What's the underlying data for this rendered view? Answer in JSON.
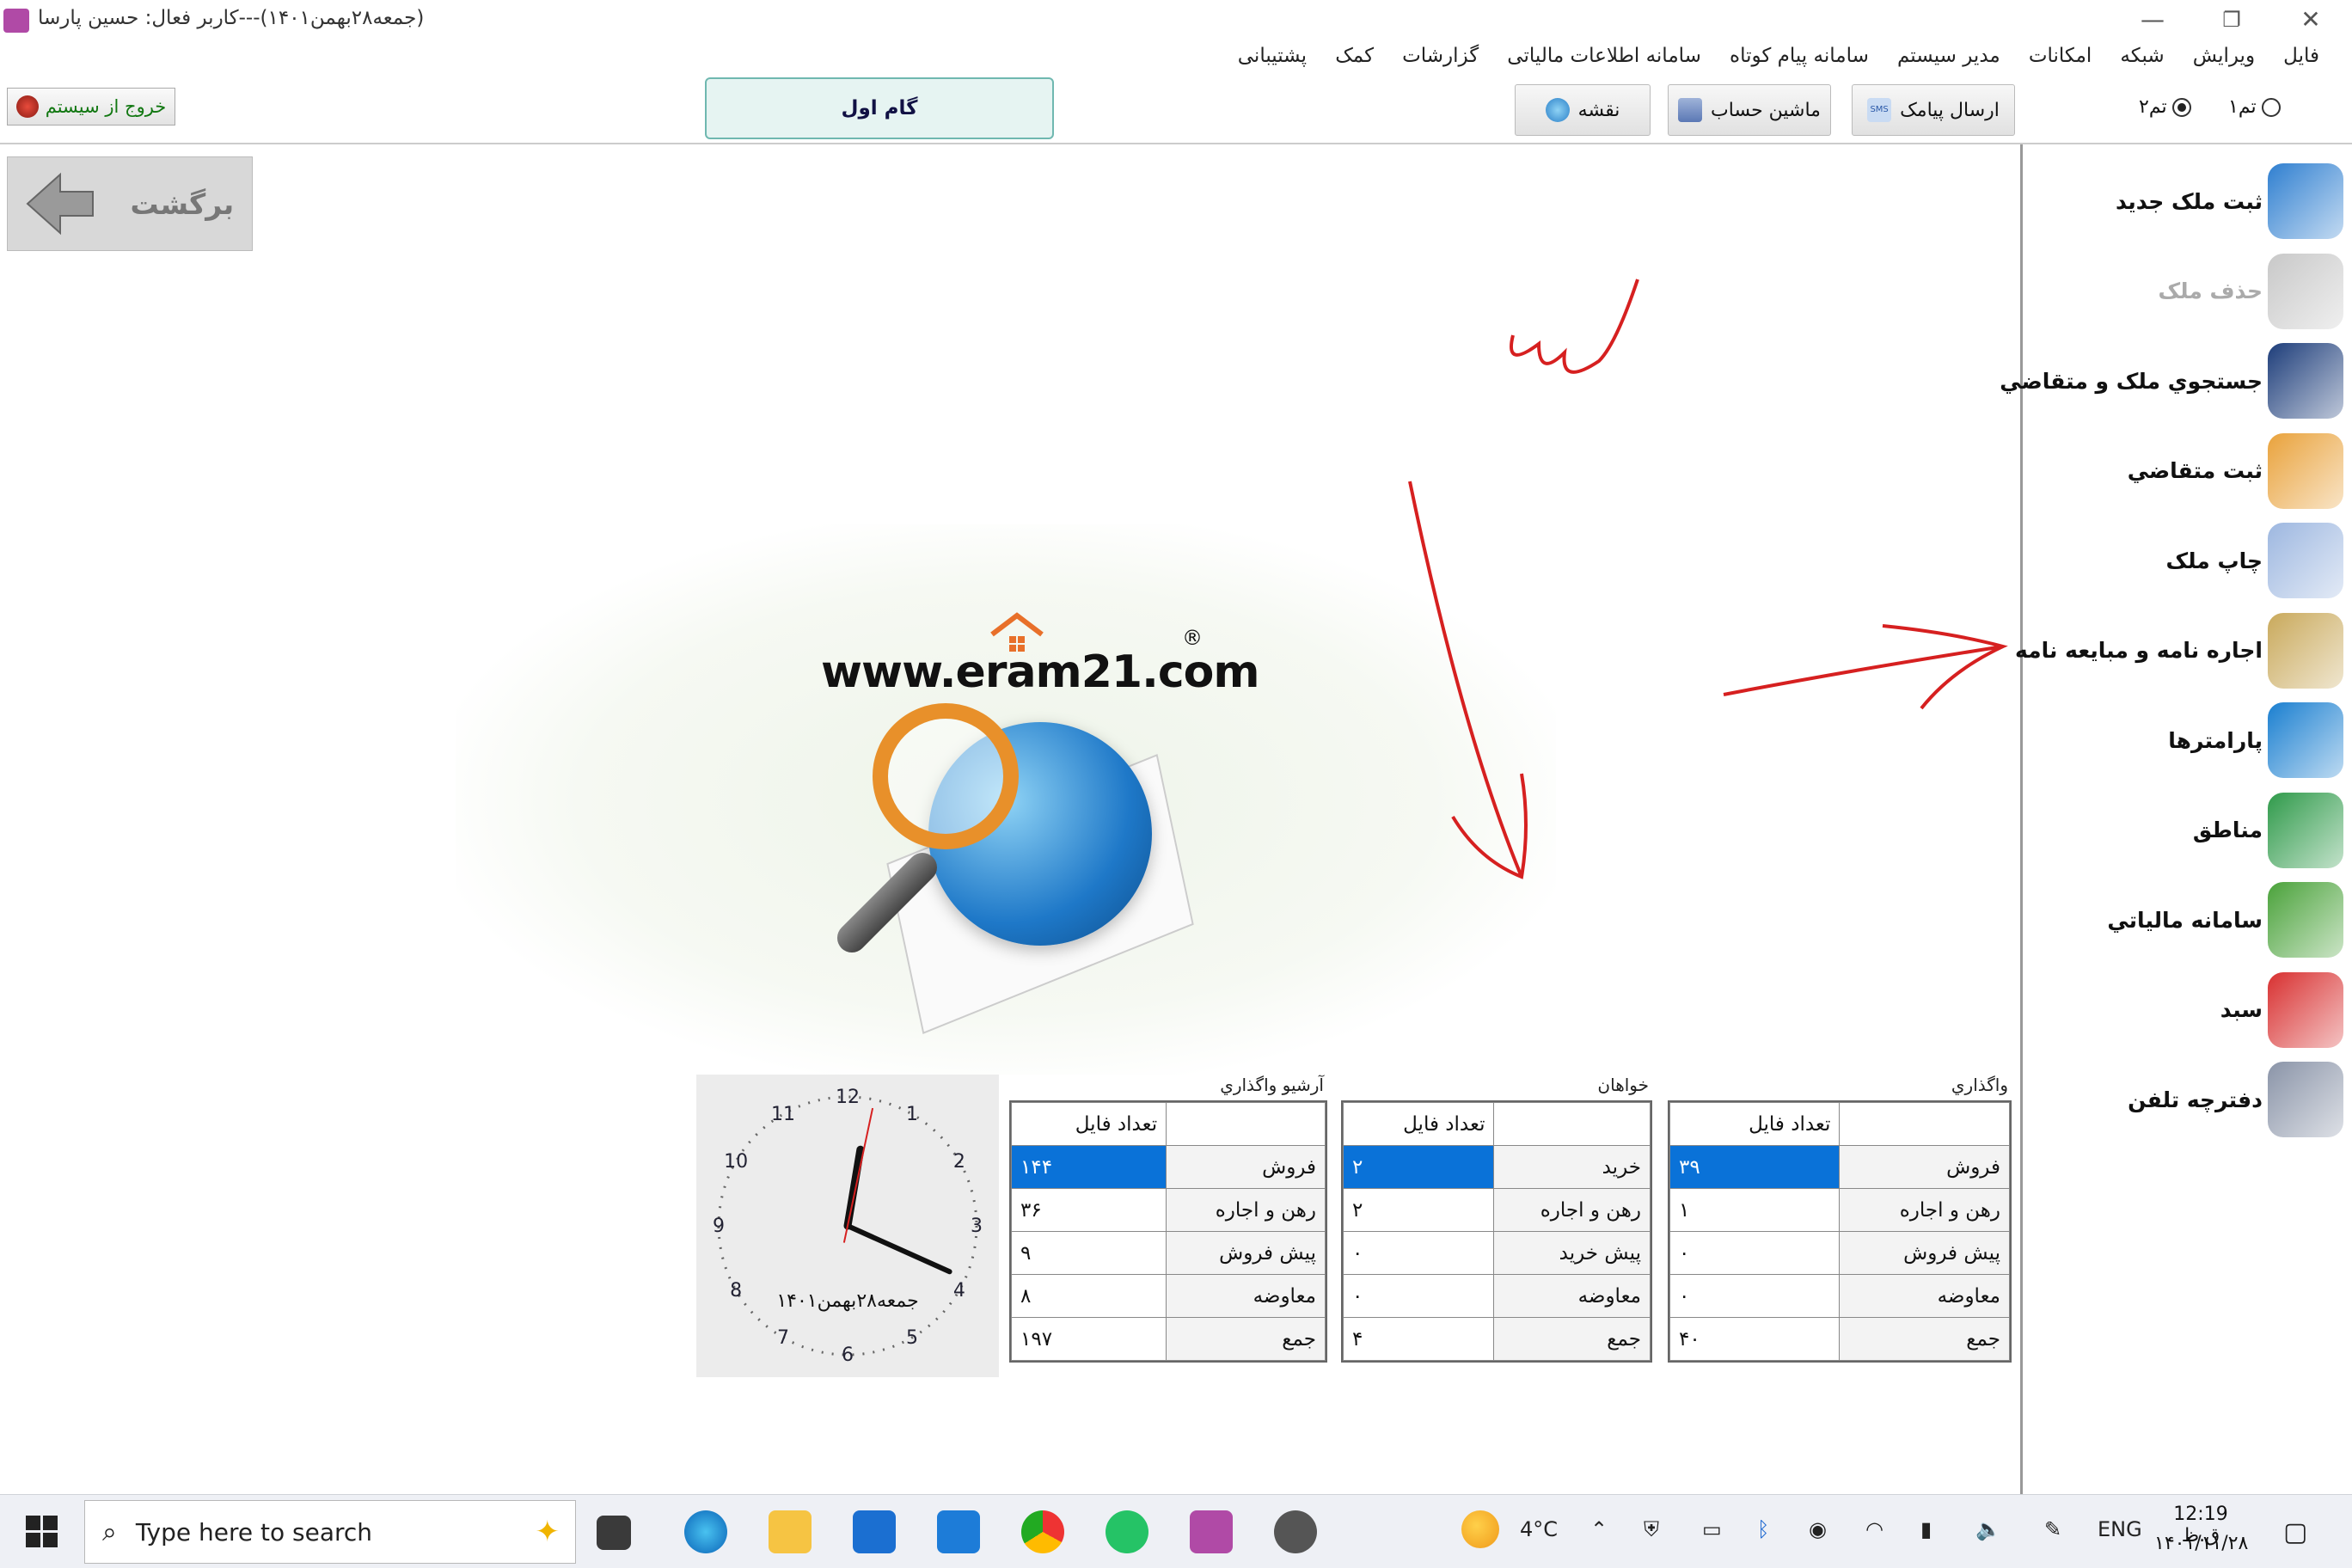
{
  "window": {
    "title": "(جمعه۲۸بهمن۱۴۰۱)---کاربر فعال: حسین پارسا",
    "minimize": "—",
    "maximize": "❐",
    "close": "✕"
  },
  "menu": [
    "فایل",
    "ویرایش",
    "شبکه",
    "امکانات",
    "مدیر سیستم",
    "سامانه پیام کوتاه",
    "سامانه اطلاعات مالیاتی",
    "گزارشات",
    "کمک",
    "پشتیبانی"
  ],
  "toolbar": {
    "theme1": "تم۱",
    "theme2": "تم۲",
    "sms": "ارسال پیامک",
    "calculator": "ماشین حساب",
    "map": "نقشه",
    "step": "گام اول",
    "exit": "خروج از سیستم"
  },
  "back_label": "برگشت",
  "sidebar": [
    {
      "label": "ثبت ملک جدید",
      "icon": "house-icon",
      "color": "#2f7fd0"
    },
    {
      "label": "حذف ملک",
      "icon": "trash-icon",
      "color": "#c8c8c8"
    },
    {
      "label": "جستجوي ملک و متقاضي",
      "icon": "binoculars-icon",
      "color": "#1d3d7a"
    },
    {
      "label": "ثبت متقاضي",
      "icon": "user-icon",
      "color": "#e9a23b"
    },
    {
      "label": "چاپ ملک",
      "icon": "printer-icon",
      "color": "#9db7e0"
    },
    {
      "label": "اجاره نامه و مبايعه نامه",
      "icon": "contract-icon",
      "color": "#c9a95b"
    },
    {
      "label": "پارامترها",
      "icon": "cubes-icon",
      "color": "#1a7fd0"
    },
    {
      "label": "مناطق",
      "icon": "globe-icon",
      "color": "#2f9a4a"
    },
    {
      "label": "سامانه مالياتي",
      "icon": "tax-chart-icon",
      "color": "#4aa23a"
    },
    {
      "label": "سبد",
      "icon": "cart-icon",
      "color": "#d83030"
    },
    {
      "label": "دفترچه تلفن",
      "icon": "phone-icon",
      "color": "#8a94a8"
    }
  ],
  "logo": {
    "text": "www.eram21.com",
    "reg": "®"
  },
  "panels": [
    {
      "title": "واگذاري",
      "header": "تعداد فایل",
      "rows": [
        {
          "label": "فروش",
          "value": "۳۹"
        },
        {
          "label": "رهن و اجاره",
          "value": "۱"
        },
        {
          "label": "پیش فروش",
          "value": "۰"
        },
        {
          "label": "معاوضه",
          "value": "۰"
        },
        {
          "label": "جمع",
          "value": "۴۰"
        }
      ]
    },
    {
      "title": "خواهان",
      "header": "تعداد فایل",
      "rows": [
        {
          "label": "خرید",
          "value": "۲"
        },
        {
          "label": "رهن و اجاره",
          "value": "۲"
        },
        {
          "label": "پیش خرید",
          "value": "۰"
        },
        {
          "label": "معاوضه",
          "value": "۰"
        },
        {
          "label": "جمع",
          "value": "۴"
        }
      ]
    },
    {
      "title": "آرشیو واگذاري",
      "header": "تعداد فایل",
      "rows": [
        {
          "label": "فروش",
          "value": "۱۴۴"
        },
        {
          "label": "رهن و اجاره",
          "value": "۳۶"
        },
        {
          "label": "پیش فروش",
          "value": "۹"
        },
        {
          "label": "معاوضه",
          "value": "۸"
        },
        {
          "label": "جمع",
          "value": "۱۹۷"
        }
      ]
    }
  ],
  "clock": {
    "date": "جمعه۲۸بهمن۱۴۰۱",
    "numbers": [
      "12",
      "1",
      "2",
      "3",
      "4",
      "5",
      "6",
      "7",
      "8",
      "9",
      "10",
      "11"
    ],
    "hours": 12,
    "minutes": 19,
    "seconds": 2
  },
  "taskbar": {
    "search_placeholder": "Type here to search",
    "weather": "4°C",
    "lang": "ENG",
    "time": "12:19 ق.ظ",
    "date": "۱۴۰۱/۱۱/۲۸"
  },
  "colors": {
    "selection": "#0a72d8",
    "annotation": "#d62020",
    "step_bg": "#e6f4f2"
  }
}
